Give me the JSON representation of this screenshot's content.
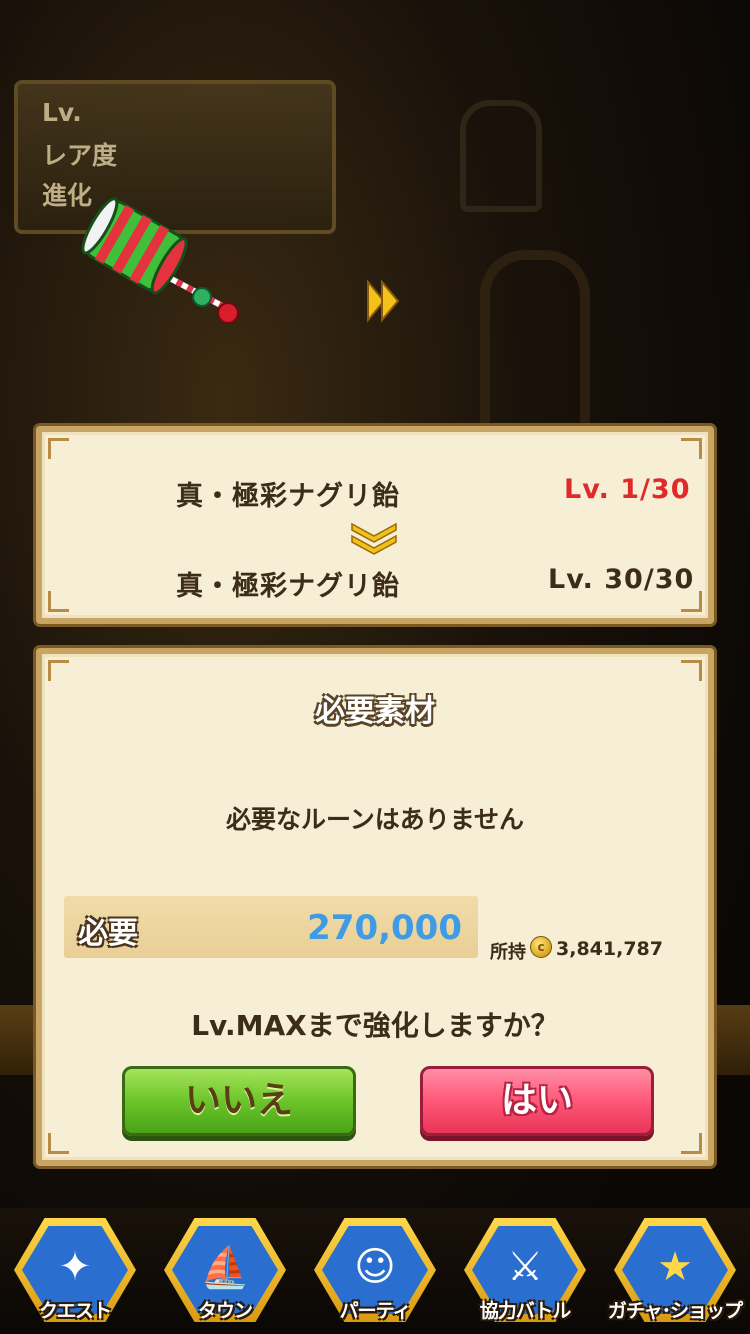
{
  "info_box": {
    "lv_label": "Lv.",
    "rarity_label": "レア度",
    "evolution_label": "進化"
  },
  "upgrade": {
    "from": {
      "name": "真・極彩ナグリ飴",
      "level": "Lv.  1/30"
    },
    "to": {
      "name": "真・極彩ナグリ飴",
      "level": "Lv.  30/30"
    },
    "from_level_color": "#e02a2a"
  },
  "dialog": {
    "title": "必要素材",
    "message": "必要なルーンはありません",
    "required_label": "必要",
    "required_value": "270,000",
    "owned_label": "所持",
    "owned_value": "3,841,787",
    "coin_symbol": "c",
    "confirm_text": "Lv.MAXまで強化しますか？",
    "no_label": "いいえ",
    "yes_label": "はい"
  },
  "nav": [
    {
      "label": "クエスト",
      "icon": "quest-map-icon",
      "glyph": "✦",
      "color": "#2a6fd0"
    },
    {
      "label": "タウン",
      "icon": "town-ship-icon",
      "glyph": "⛵",
      "color": "#2a6fd0"
    },
    {
      "label": "パーティ",
      "icon": "party-icon",
      "glyph": "☺",
      "color": "#2a6fd0"
    },
    {
      "label": "協力バトル",
      "icon": "shield-sword-icon",
      "glyph": "⚔",
      "color": "#2a6fd0"
    },
    {
      "label": "ガチャ･ショップ",
      "icon": "star-icon",
      "glyph": "★",
      "color": "#2a6fd0"
    }
  ]
}
